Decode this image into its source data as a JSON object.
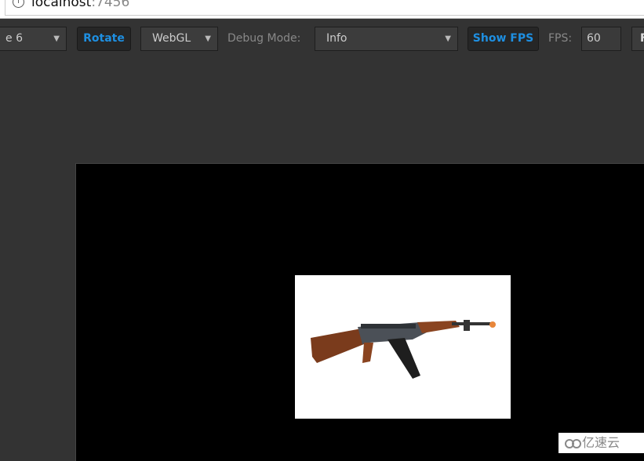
{
  "address_bar": {
    "host": "localhost",
    "port": ":7456"
  },
  "toolbar": {
    "device_select": "e 6",
    "rotate_label": "Rotate",
    "renderer_select": "WebGL",
    "debug_mode_label": "Debug Mode:",
    "debug_mode_select": "Info",
    "show_fps_label": "Show FPS",
    "fps_label": "FPS:",
    "fps_value": "60",
    "next_button_partial": "F"
  },
  "watermark": "亿速云",
  "colors": {
    "accent": "#1e8fe1",
    "toolbar_bg": "#333333",
    "canvas_bg": "#000000"
  }
}
